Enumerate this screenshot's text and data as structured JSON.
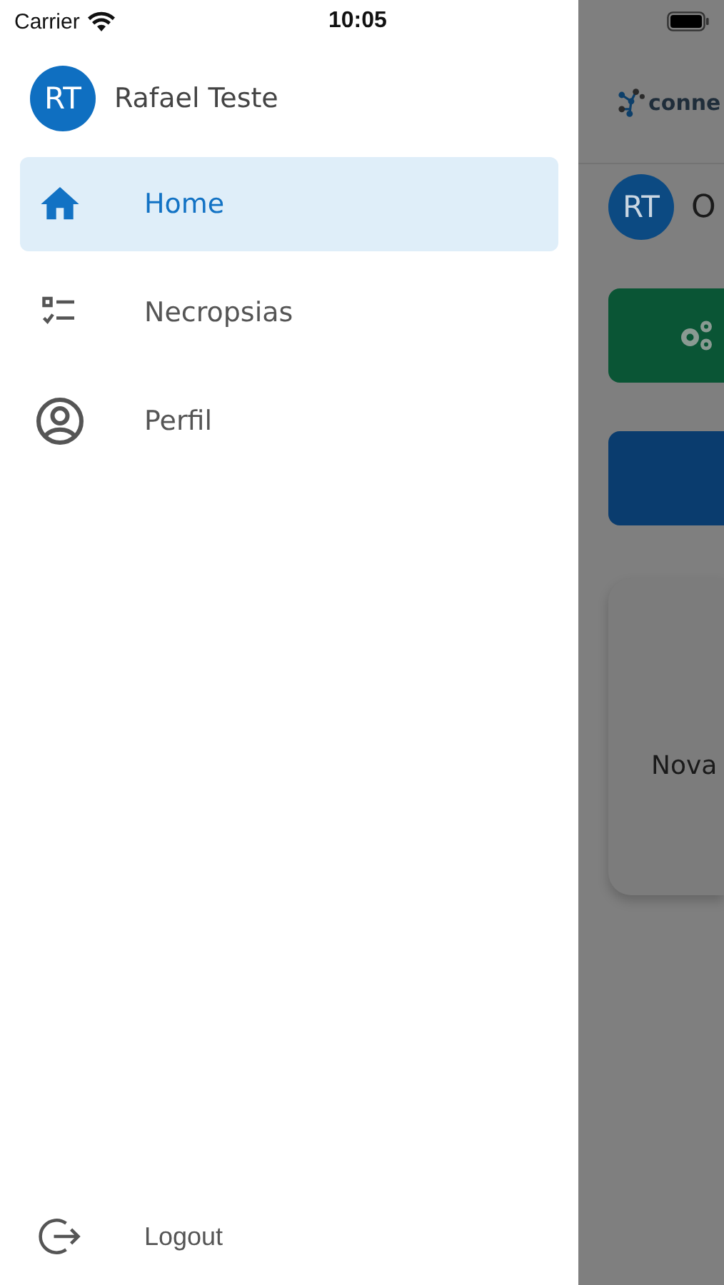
{
  "status_bar": {
    "carrier": "Carrier",
    "time": "10:05"
  },
  "drawer": {
    "user": {
      "initials": "RT",
      "name": "Rafael Teste"
    },
    "items": [
      {
        "label": "Home",
        "kind": "home",
        "selected": true
      },
      {
        "label": "Necropsias",
        "kind": "checklist",
        "selected": false
      },
      {
        "label": "Perfil",
        "kind": "person",
        "selected": false
      }
    ],
    "logout": {
      "label": "Logout"
    }
  },
  "background": {
    "logo_text": "conne",
    "user_initials": "RT",
    "user_name": "O",
    "card_text": "Nova"
  }
}
